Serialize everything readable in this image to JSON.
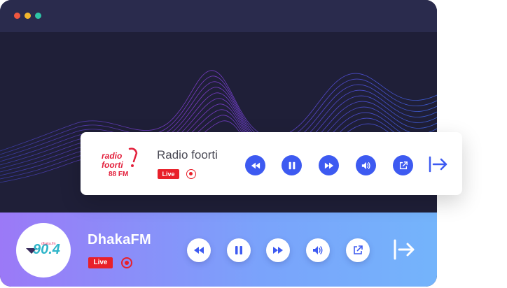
{
  "window": {
    "title_dots": [
      "close-dot",
      "minimize-dot",
      "maximize-dot"
    ]
  },
  "card_player": {
    "logo_line1": "radio",
    "logo_line2": "foorti",
    "logo_line3": "88 FM",
    "station_name": "Radio foorti",
    "live_badge": "Live",
    "controls": [
      "rewind-icon",
      "pause-icon",
      "fast-forward-icon",
      "volume-icon",
      "external-link-icon",
      "exit-icon"
    ],
    "accent_color": "#3d5af1"
  },
  "bottom_player": {
    "logo_text": "90.4",
    "logo_subtext": "dhaka.fm",
    "station_name": "DhakaFM",
    "live_badge": "Live",
    "controls": [
      "rewind-icon",
      "pause-icon",
      "fast-forward-icon",
      "volume-icon",
      "external-link-icon",
      "exit-icon"
    ],
    "accent_color": "#3d5af1"
  }
}
